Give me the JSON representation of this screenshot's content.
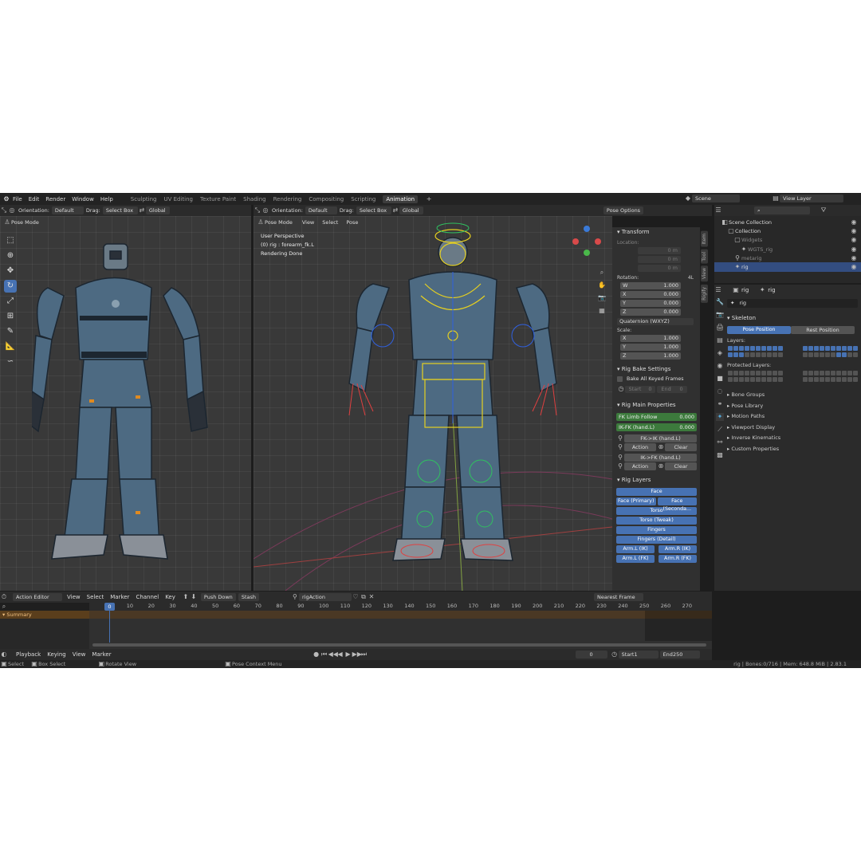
{
  "topbar": {
    "menu": [
      "File",
      "Edit",
      "Render",
      "Window",
      "Help"
    ],
    "workspaces": [
      "Sculpting",
      "UV Editing",
      "Texture Paint",
      "Shading",
      "Rendering",
      "Compositing",
      "Scripting",
      "Animation"
    ],
    "active_workspace": "Animation",
    "scene": "Scene",
    "view_layer": "View Layer"
  },
  "left_view": {
    "mode": "Pose Mode",
    "orientation_label": "Orientation:",
    "orientation": "Default",
    "drag_label": "Drag:",
    "drag": "Select Box",
    "transform": "Global"
  },
  "right_view": {
    "mode": "Pose Mode",
    "menu": [
      "View",
      "Select",
      "Pose"
    ],
    "orientation_label": "Orientation:",
    "orientation": "Default",
    "drag_label": "Drag:",
    "drag": "Select Box",
    "transform": "Global",
    "pose_options": "Pose Options",
    "overlay_lines": [
      "User Perspective",
      "(0) rig : forearm_fk.L",
      "Rendering Done"
    ]
  },
  "npanel": {
    "transform": "Transform",
    "location": "Location:",
    "loc_vals": [
      "0 m",
      "0 m",
      "0 m"
    ],
    "rotation": "Rotation:",
    "rot_mode_short": "4L",
    "rot": [
      {
        "k": "W",
        "v": "1.000"
      },
      {
        "k": "X",
        "v": "0.000"
      },
      {
        "k": "Y",
        "v": "0.000"
      },
      {
        "k": "Z",
        "v": "0.000"
      }
    ],
    "rot_mode": "Quaternion (WXYZ)",
    "scale": "Scale:",
    "scl": [
      {
        "k": "X",
        "v": "1.000"
      },
      {
        "k": "Y",
        "v": "1.000"
      },
      {
        "k": "Z",
        "v": "1.000"
      }
    ],
    "bake": "Rig Bake Settings",
    "bake_all": "Bake All Keyed Frames",
    "start": "Start",
    "start_v": "0",
    "end": "End",
    "end_v": "0",
    "main": "Rig Main Properties",
    "fk_follow": "FK Limb Follow",
    "fk_follow_v": "0.000",
    "ikfk": "IK-FK (hand.L)",
    "ikfk_v": "0.000",
    "fk_ik": "FK->IK (hand.L)",
    "ik_fk": "IK->FK (hand.L)",
    "action": "Action",
    "clear": "Clear",
    "layers": "Rig Layers",
    "face": "Face",
    "face_p": "Face (Primary)",
    "face_s": "Face (Seconda...",
    "torso": "Torso",
    "torso_t": "Torso (Tweak)",
    "fingers": "Fingers",
    "fingers_d": "Fingers (Detail)",
    "arm_l_ik": "Arm.L (IK)",
    "arm_r_ik": "Arm.R (IK)",
    "arm_l_fk": "Arm.L (FK)",
    "arm_r_fk": "Arm.R (FK)",
    "tabs": [
      "Item",
      "Tool",
      "View",
      "Rigify"
    ]
  },
  "outliner": {
    "items": [
      {
        "label": "Scene Collection",
        "indent": 0
      },
      {
        "label": "Collection",
        "indent": 1
      },
      {
        "label": "Widgets",
        "indent": 2
      },
      {
        "label": "WGTS_rig",
        "indent": 3
      },
      {
        "label": "metarig",
        "indent": 2
      },
      {
        "label": "rig",
        "indent": 2
      }
    ]
  },
  "properties": {
    "tab_rig": "rig",
    "tab_rig2": "rig",
    "name": "rig",
    "skeleton": "Skeleton",
    "pose_position": "Pose Position",
    "rest_position": "Rest Position",
    "layers": "Layers:",
    "protected": "Protected Layers:",
    "sections": [
      "Bone Groups",
      "Pose Library",
      "Motion Paths",
      "Viewport Display",
      "Inverse Kinematics",
      "Custom Properties"
    ]
  },
  "action_editor": {
    "editor": "Action Editor",
    "menu": [
      "View",
      "Select",
      "Marker",
      "Channel",
      "Key"
    ],
    "push_down": "Push Down",
    "stash": "Stash",
    "action": "rigAction",
    "snap": "Nearest Frame",
    "summary": "Summary",
    "frames": [
      "0",
      "10",
      "20",
      "30",
      "40",
      "50",
      "60",
      "70",
      "80",
      "90",
      "100",
      "110",
      "120",
      "130",
      "140",
      "150",
      "160",
      "170",
      "180",
      "190",
      "200",
      "210",
      "220",
      "230",
      "240",
      "250",
      "260",
      "270"
    ]
  },
  "playback": {
    "menu": [
      "Playback",
      "Keying",
      "View",
      "Marker"
    ],
    "frame": "0",
    "start_label": "Start",
    "start": "1",
    "end_label": "End",
    "end": "250"
  },
  "status": {
    "select": "Select",
    "box_select": "Box Select",
    "rotate": "Rotate View",
    "context": "Pose Context Menu",
    "info": "rig | Bones:0/716 | Mem: 648.8 MiB | 2.83.1"
  }
}
